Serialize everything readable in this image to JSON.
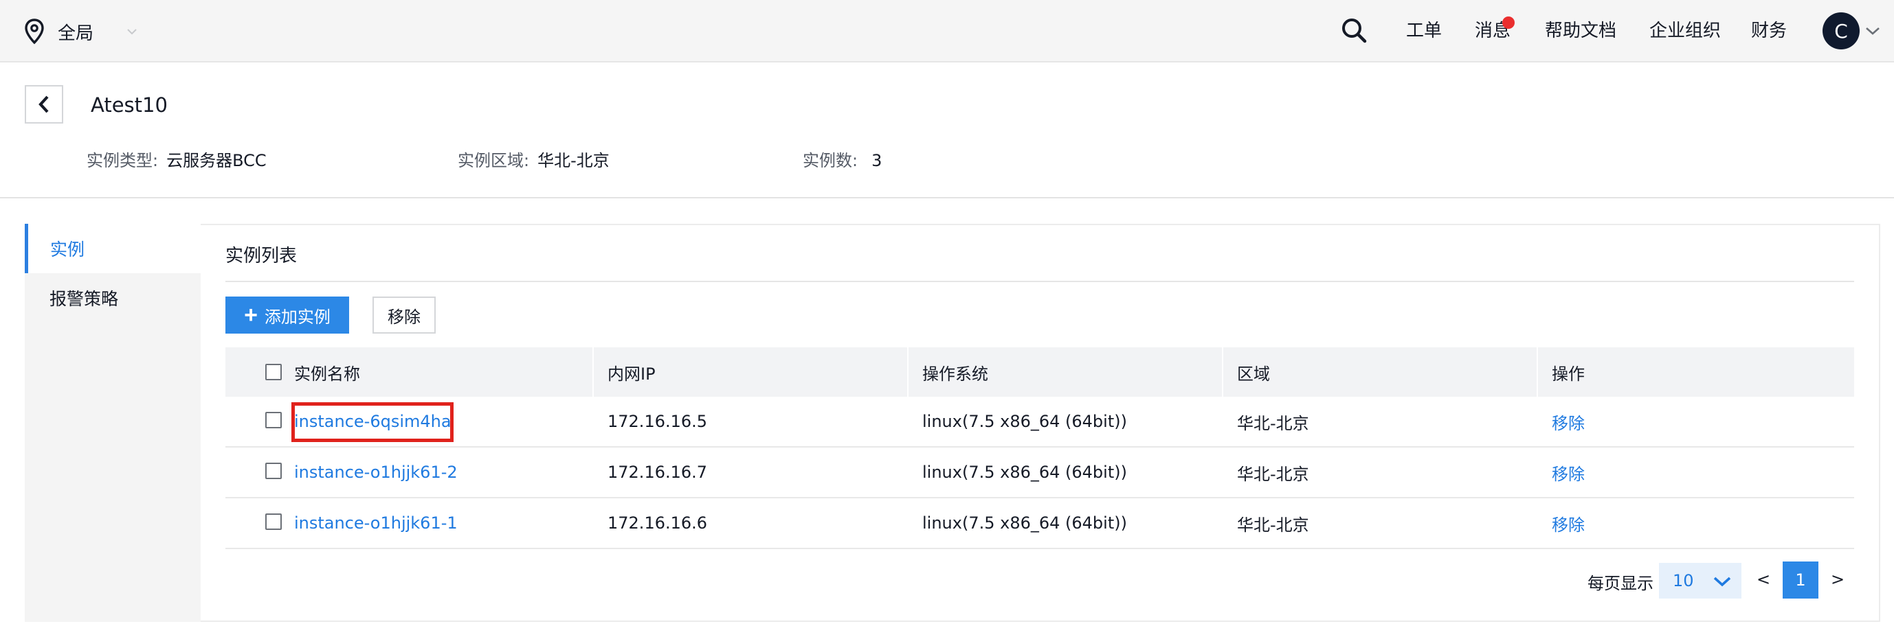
{
  "topbar": {
    "region_label": "全局",
    "nav": {
      "tickets": "工单",
      "messages": "消息",
      "help_docs": "帮助文档",
      "organization": "企业组织",
      "finance": "财务"
    },
    "avatar_letter": "C"
  },
  "header": {
    "title": "Atest10",
    "instance_type_key": "实例类型:",
    "instance_type_value": "云服务器BCC",
    "region_key": "实例区域:",
    "region_value": "华北-北京",
    "count_key": "实例数:",
    "count_value": "3"
  },
  "sidebar": {
    "items": [
      {
        "label": "实例"
      },
      {
        "label": "报警策略"
      }
    ]
  },
  "main": {
    "section_title": "实例列表",
    "add_button": "添加实例",
    "remove_button": "移除"
  },
  "table": {
    "columns": [
      "实例名称",
      "内网IP",
      "操作系统",
      "区域",
      "操作"
    ],
    "rows": [
      {
        "name": "instance-6qsim4ha",
        "ip": "172.16.16.5",
        "os": "linux(7.5 x86_64 (64bit))",
        "region": "华北-北京",
        "action": "移除"
      },
      {
        "name": "instance-o1hjjk61-2",
        "ip": "172.16.16.7",
        "os": "linux(7.5 x86_64 (64bit))",
        "region": "华北-北京",
        "action": "移除"
      },
      {
        "name": "instance-o1hjjk61-1",
        "ip": "172.16.16.6",
        "os": "linux(7.5 x86_64 (64bit))",
        "region": "华北-北京",
        "action": "移除"
      }
    ]
  },
  "pagination": {
    "per_page_label": "每页显示",
    "per_page_value": "10",
    "prev": "<",
    "current_page": "1",
    "next": ">"
  },
  "colors": {
    "accent": "#2c88e6",
    "link": "#1f7ae0",
    "highlight": "#e0221c",
    "badge": "#ea2e2e",
    "avatar_bg": "#101a2e"
  }
}
